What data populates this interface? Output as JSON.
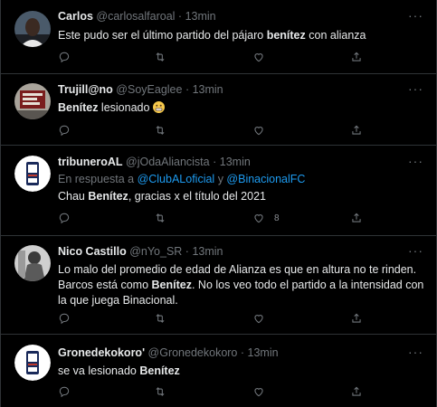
{
  "colors": {
    "background": "#000000",
    "accent": "#1d9bf0",
    "muted": "#71767b"
  },
  "tweets": [
    {
      "name": "Carlos",
      "handle": "@carlosalfaroal",
      "separator": "·",
      "time": "13min",
      "body": [
        {
          "text": "Este pudo ser el último partido del pájaro "
        },
        {
          "text": "benítez",
          "bold": true
        },
        {
          "text": " con alianza"
        }
      ],
      "like_count": ""
    },
    {
      "name": "Trujill@no",
      "handle": "@SoyEaglee",
      "separator": "·",
      "time": "13min",
      "body": [
        {
          "text": "Benítez",
          "bold": true
        },
        {
          "text": " lesionado "
        }
      ],
      "emoji": "grimacing-face-emoji",
      "like_count": ""
    },
    {
      "name": "tribuneroAL",
      "handle": "@jOdaAliancista",
      "separator": "·",
      "time": "13min",
      "reply_prefix": "En respuesta a ",
      "reply_mention_1": "@ClubALoficial",
      "reply_join": " y ",
      "reply_mention_2": "@BinacionalFC",
      "body": [
        {
          "text": "Chau "
        },
        {
          "text": "Benítez",
          "bold": true
        },
        {
          "text": ", gracias x el título del 2021"
        }
      ],
      "like_count": "8"
    },
    {
      "name": "Nico Castillo",
      "handle": "@nYo_SR",
      "separator": "·",
      "time": "13min",
      "body": [
        {
          "text": "Lo malo del promedio de edad de Alianza es que en altura no te rinden. Barcos está como "
        },
        {
          "text": "Benítez",
          "bold": true
        },
        {
          "text": ". No los veo todo el partido a la intensidad con la que juega Binacional."
        }
      ],
      "like_count": ""
    },
    {
      "name": "Gronedekokoro'",
      "handle": "@Gronedekokoro",
      "separator": "·",
      "time": "13min",
      "body": [
        {
          "text": "se va lesionado "
        },
        {
          "text": "Benítez",
          "bold": true
        }
      ],
      "like_count": ""
    }
  ]
}
